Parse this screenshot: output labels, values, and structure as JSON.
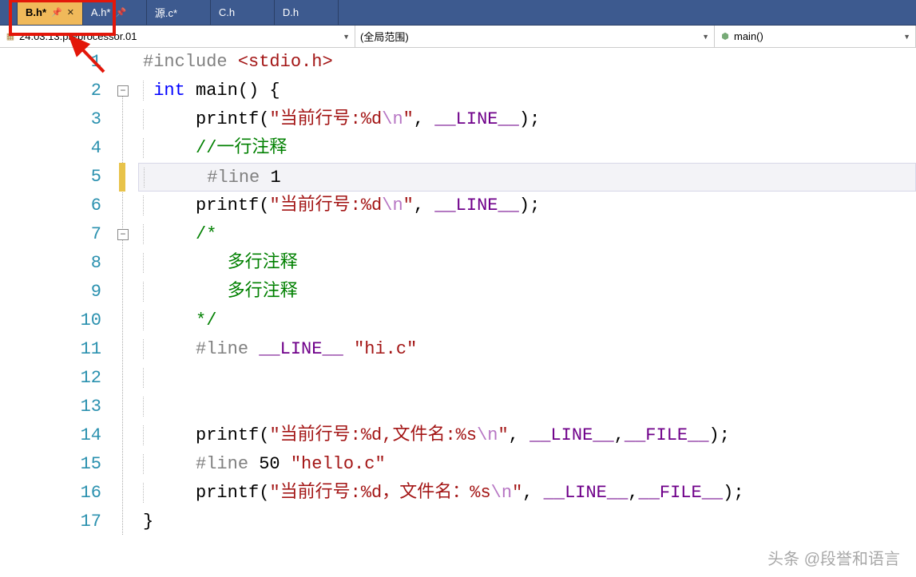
{
  "tabs": [
    {
      "label": "B.h*",
      "active": true,
      "pinned": true,
      "closeable": true
    },
    {
      "label": "A.h*",
      "active": false,
      "pinned": true,
      "closeable": false
    },
    {
      "label": "源.c*",
      "active": false,
      "pinned": false,
      "closeable": false
    },
    {
      "label": "C.h",
      "active": false,
      "pinned": false,
      "closeable": false
    },
    {
      "label": "D.h",
      "active": false,
      "pinned": false,
      "closeable": false
    }
  ],
  "nav": {
    "project": "24.03.13.preprocessor.01",
    "scope": "(全局范围)",
    "symbol": "main()"
  },
  "code": {
    "lines": [
      {
        "n": 1,
        "tokens": [
          [
            "pp",
            "#include "
          ],
          [
            "inc",
            "<stdio.h>"
          ]
        ]
      },
      {
        "n": 2,
        "fold": "-",
        "tokens": [
          [
            "kw",
            "int"
          ],
          [
            "txt",
            " "
          ],
          [
            "fn",
            "main"
          ],
          [
            "txt",
            "() {"
          ]
        ]
      },
      {
        "n": 3,
        "tokens": [
          [
            "txt",
            "    "
          ],
          [
            "fn",
            "printf"
          ],
          [
            "txt",
            "("
          ],
          [
            "str",
            "\"当前行号:%d"
          ],
          [
            "esc",
            "\\n"
          ],
          [
            "str",
            "\""
          ],
          [
            "txt",
            ", "
          ],
          [
            "mac",
            "__LINE__"
          ],
          [
            "txt",
            ");"
          ]
        ]
      },
      {
        "n": 4,
        "tokens": [
          [
            "txt",
            "    "
          ],
          [
            "cmt",
            "//一行注释"
          ]
        ]
      },
      {
        "n": 5,
        "hl": true,
        "chg": true,
        "tokens": [
          [
            "txt",
            "     "
          ],
          [
            "pp",
            "#line"
          ],
          [
            "txt",
            " "
          ],
          [
            "num",
            "1"
          ]
        ]
      },
      {
        "n": 6,
        "tokens": [
          [
            "txt",
            "    "
          ],
          [
            "fn",
            "printf"
          ],
          [
            "txt",
            "("
          ],
          [
            "str",
            "\"当前行号:%d"
          ],
          [
            "esc",
            "\\n"
          ],
          [
            "str",
            "\""
          ],
          [
            "txt",
            ", "
          ],
          [
            "mac",
            "__LINE__"
          ],
          [
            "txt",
            ");"
          ]
        ]
      },
      {
        "n": 7,
        "fold": "-",
        "tokens": [
          [
            "txt",
            "    "
          ],
          [
            "cmt",
            "/*"
          ]
        ]
      },
      {
        "n": 8,
        "tokens": [
          [
            "txt",
            "       "
          ],
          [
            "cmt",
            "多行注释"
          ]
        ]
      },
      {
        "n": 9,
        "tokens": [
          [
            "txt",
            "       "
          ],
          [
            "cmt",
            "多行注释"
          ]
        ]
      },
      {
        "n": 10,
        "tokens": [
          [
            "txt",
            "    "
          ],
          [
            "cmt",
            "*/"
          ]
        ]
      },
      {
        "n": 11,
        "tokens": [
          [
            "txt",
            "    "
          ],
          [
            "pp",
            "#line"
          ],
          [
            "txt",
            " "
          ],
          [
            "mac",
            "__LINE__"
          ],
          [
            "txt",
            " "
          ],
          [
            "str",
            "\"hi.c\""
          ]
        ]
      },
      {
        "n": 12,
        "tokens": []
      },
      {
        "n": 13,
        "tokens": []
      },
      {
        "n": 14,
        "tokens": [
          [
            "txt",
            "    "
          ],
          [
            "fn",
            "printf"
          ],
          [
            "txt",
            "("
          ],
          [
            "str",
            "\"当前行号:%d,文件名:%s"
          ],
          [
            "esc",
            "\\n"
          ],
          [
            "str",
            "\""
          ],
          [
            "txt",
            ", "
          ],
          [
            "mac",
            "__LINE__"
          ],
          [
            "txt",
            ","
          ],
          [
            "mac",
            "__FILE__"
          ],
          [
            "txt",
            ");"
          ]
        ]
      },
      {
        "n": 15,
        "tokens": [
          [
            "txt",
            "    "
          ],
          [
            "pp",
            "#line"
          ],
          [
            "txt",
            " "
          ],
          [
            "num",
            "50"
          ],
          [
            "txt",
            " "
          ],
          [
            "str",
            "\"hello.c\""
          ]
        ]
      },
      {
        "n": 16,
        "tokens": [
          [
            "txt",
            "    "
          ],
          [
            "fn",
            "printf"
          ],
          [
            "txt",
            "("
          ],
          [
            "str",
            "\"当前行号:%d，文件名：%s"
          ],
          [
            "esc",
            "\\n"
          ],
          [
            "str",
            "\""
          ],
          [
            "txt",
            ", "
          ],
          [
            "mac",
            "__LINE__"
          ],
          [
            "txt",
            ","
          ],
          [
            "mac",
            "__FILE__"
          ],
          [
            "txt",
            ");"
          ]
        ]
      },
      {
        "n": 17,
        "tokens": [
          [
            "txt",
            "}"
          ]
        ]
      }
    ]
  },
  "watermark": "头条 @段誉和语言"
}
